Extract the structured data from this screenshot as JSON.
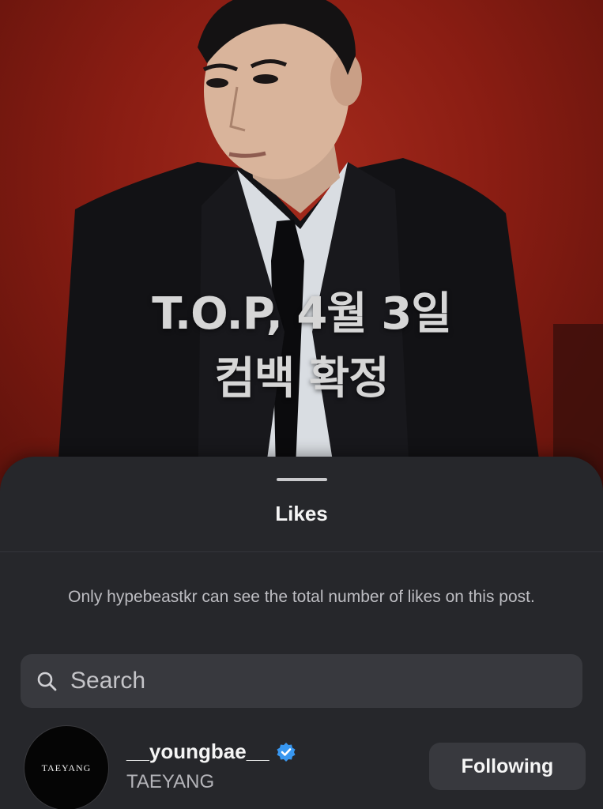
{
  "post": {
    "headline_line1": "T.O.P, 4월 3일",
    "headline_line2": "컴백 확정"
  },
  "likes_sheet": {
    "title": "Likes",
    "notice": "Only hypebeastkr can see the total number of likes on this post.",
    "search": {
      "placeholder": "Search",
      "value": ""
    },
    "users": [
      {
        "username": "__youngbae__",
        "full_name": "TAEYANG",
        "avatar_text": "TAEYANG",
        "verified": true,
        "button_label": "Following"
      }
    ]
  },
  "colors": {
    "sheet_background": "#26272b",
    "search_background": "#38393e",
    "verified_badge": "#3897f0",
    "photo_background": "#8a1d13"
  },
  "icons": {
    "search": "search-icon",
    "verified": "verified-badge-icon",
    "grabber": "sheet-grabber"
  }
}
